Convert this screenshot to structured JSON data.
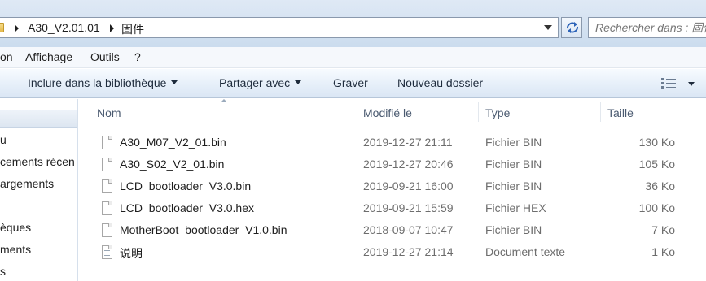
{
  "address_bar": {
    "breadcrumbs": [
      "A30_V2.01.01",
      "固件"
    ]
  },
  "search": {
    "placeholder": "Rechercher dans : 固件"
  },
  "menu": {
    "items": [
      "on",
      "Affichage",
      "Outils",
      "?"
    ]
  },
  "toolbar": {
    "include_label": "Inclure dans la bibliothèque",
    "share_label": "Partager avec",
    "burn_label": "Graver",
    "new_folder_label": "Nouveau dossier"
  },
  "nav": {
    "items": [
      "u",
      "cements récen",
      "argements",
      "èques",
      "ments",
      "s"
    ]
  },
  "columns": {
    "name": "Nom",
    "modified": "Modifié le",
    "type": "Type",
    "size": "Taille"
  },
  "files": [
    {
      "name": "A30_M07_V2_01.bin",
      "date": "2019-12-27 21:11",
      "type": "Fichier BIN",
      "size": "130 Ko",
      "icon": "bin-file-icon"
    },
    {
      "name": "A30_S02_V2_01.bin",
      "date": "2019-12-27 20:46",
      "type": "Fichier BIN",
      "size": "105 Ko",
      "icon": "bin-file-icon"
    },
    {
      "name": "LCD_bootloader_V3.0.bin",
      "date": "2019-09-21 16:00",
      "type": "Fichier BIN",
      "size": "36 Ko",
      "icon": "bin-file-icon"
    },
    {
      "name": "LCD_bootloader_V3.0.hex",
      "date": "2019-09-21 15:59",
      "type": "Fichier HEX",
      "size": "100 Ko",
      "icon": "hex-file-icon"
    },
    {
      "name": "MotherBoot_bootloader_V1.0.bin",
      "date": "2018-09-07 10:47",
      "type": "Fichier BIN",
      "size": "7 Ko",
      "icon": "bin-file-icon"
    },
    {
      "name": "说明",
      "date": "2019-12-27 21:14",
      "type": "Document texte",
      "size": "1 Ko",
      "icon": "text-document-icon"
    }
  ]
}
